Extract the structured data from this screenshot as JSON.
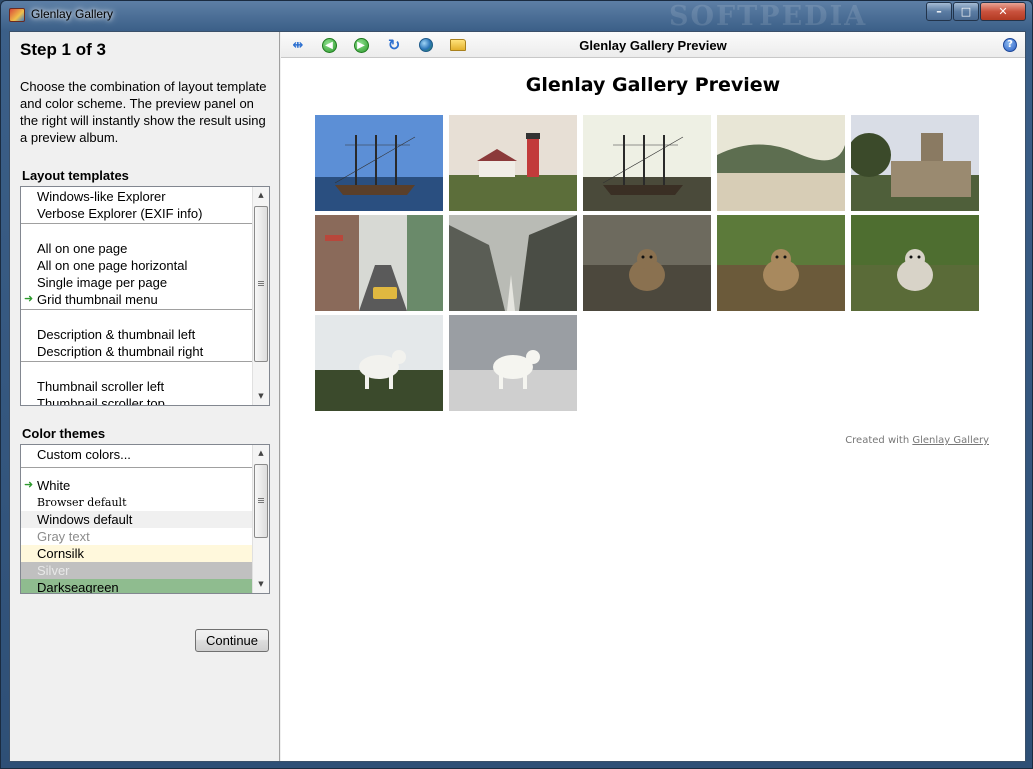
{
  "window": {
    "title": "Glenlay Gallery",
    "watermark": "SOFTPEDIA",
    "controls": {
      "minimize": "–",
      "maximize": "□",
      "close": "✕"
    }
  },
  "wizard": {
    "step_title": "Step 1 of 3",
    "intro": "Choose the combination of layout template and color scheme. The preview panel on the right will instantly show the result using a preview album.",
    "layout_label": "Layout templates",
    "layout_groups": [
      [
        "Windows-like Explorer",
        "Verbose Explorer (EXIF info)"
      ],
      [
        "All on one page",
        "All on one page horizontal",
        "Single image per page",
        "Grid thumbnail menu"
      ],
      [
        "Description & thumbnail left",
        "Description & thumbnail right"
      ],
      [
        "Thumbnail scroller left",
        "Thumbnail scroller top"
      ]
    ],
    "layout_selected": "Grid thumbnail menu",
    "color_label": "Color themes",
    "custom_colors": "Custom colors...",
    "color_items": [
      {
        "label": "White",
        "bg": "#ffffff",
        "fg": "#000000",
        "selected": true
      },
      {
        "label": "Browser default",
        "bg": "#ffffff",
        "fg": "#000000",
        "serif": true
      },
      {
        "label": "Windows default",
        "bg": "#f0f0f0",
        "fg": "#000000"
      },
      {
        "label": "Gray text",
        "bg": "#ffffff",
        "fg": "#8c8c8c"
      },
      {
        "label": "Cornsilk",
        "bg": "#fff8dc",
        "fg": "#000000"
      },
      {
        "label": "Silver",
        "bg": "#c0c0c0",
        "fg": "#e8e8e8"
      },
      {
        "label": "Darkseagreen",
        "bg": "#8fbc8f",
        "fg": "#000000"
      }
    ],
    "continue_label": "Continue"
  },
  "preview": {
    "toolbar_title": "Glenlay Gallery Preview",
    "toolbar_icons": [
      "split-view-icon",
      "back-arrow-icon",
      "forward-arrow-icon",
      "refresh-icon",
      "globe-icon",
      "open-folder-icon",
      "help-icon"
    ],
    "page_title": "Glenlay Gallery Preview",
    "credit_prefix": "Created with",
    "credit_link": "Glenlay Gallery",
    "thumbnails": [
      {
        "name": "tall-ship-harbor",
        "sky": "#5c8fd6",
        "ground": "#2a4f80",
        "accent": "#5a3f2a",
        "kind": "ship"
      },
      {
        "name": "lighthouse",
        "sky": "#e7dfd5",
        "ground": "#5c6e3a",
        "accent": "#c23b3b",
        "kind": "lighthouse"
      },
      {
        "name": "sailing-ship-dock",
        "sky": "#eef0e4",
        "ground": "#4a4a3a",
        "accent": "#3a2f24",
        "kind": "ship"
      },
      {
        "name": "beach-cove",
        "sky": "#e8e6d6",
        "ground": "#d7cdb6",
        "accent": "#5d6e50",
        "kind": "beach"
      },
      {
        "name": "mission-church",
        "sky": "#d9dde6",
        "ground": "#4f5f3a",
        "accent": "#8a7a62",
        "kind": "church"
      },
      {
        "name": "city-street",
        "sky": "#d7d9d4",
        "ground": "#5a5a5a",
        "accent": "#b8473b",
        "kind": "street"
      },
      {
        "name": "waterfall-canyon",
        "sky": "#b9bbb5",
        "ground": "#5a5d55",
        "accent": "#e6e6e0",
        "kind": "canyon"
      },
      {
        "name": "marmot-rocks",
        "sky": "#6d6a5e",
        "ground": "#4c483d",
        "accent": "#8a7150",
        "kind": "animal"
      },
      {
        "name": "marmot-grass",
        "sky": "#5c7a3a",
        "ground": "#6b5a3a",
        "accent": "#a8895e",
        "kind": "animal"
      },
      {
        "name": "marmot-meadow",
        "sky": "#4e6e30",
        "ground": "#5a6b38",
        "accent": "#d8d3c8",
        "kind": "animal"
      },
      {
        "name": "mountain-goat-forest",
        "sky": "#e4e8ea",
        "ground": "#3b4a2c",
        "accent": "#f2f2ee",
        "kind": "goat"
      },
      {
        "name": "mountain-goat-parking",
        "sky": "#9a9ea3",
        "ground": "#cfcfcf",
        "accent": "#f5f5f0",
        "kind": "goat"
      }
    ]
  }
}
